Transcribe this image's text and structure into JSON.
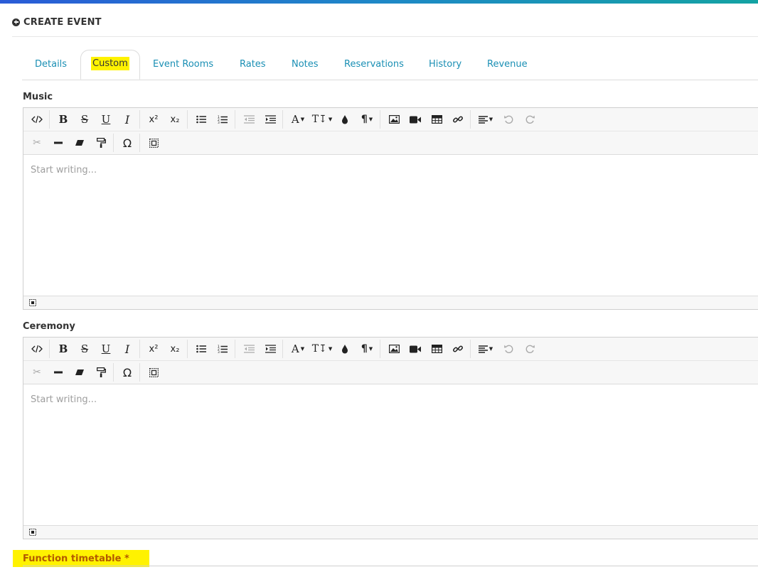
{
  "header": {
    "title": "CREATE EVENT",
    "icon": "plus-circle-icon"
  },
  "tabs": [
    {
      "label": "Details",
      "active": false
    },
    {
      "label": "Custom",
      "active": true
    },
    {
      "label": "Event Rooms",
      "active": false
    },
    {
      "label": "Rates",
      "active": false
    },
    {
      "label": "Notes",
      "active": false
    },
    {
      "label": "Reservations",
      "active": false
    },
    {
      "label": "History",
      "active": false
    },
    {
      "label": "Revenue",
      "active": false
    }
  ],
  "fields": {
    "music": {
      "label": "Music",
      "placeholder": "Start writing..."
    },
    "ceremony": {
      "label": "Ceremony",
      "placeholder": "Start writing..."
    },
    "function_timetable": {
      "label": "Function timetable",
      "required": "*"
    }
  },
  "colors": {
    "accent": "#1a8fb4",
    "highlight": "#fff200",
    "required_label": "#b35900"
  }
}
